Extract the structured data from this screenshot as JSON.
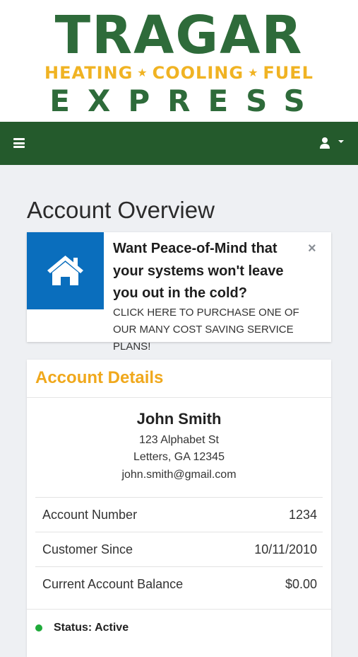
{
  "logo": {
    "title": "TRAGAR",
    "subtitle_parts": [
      "HEATING",
      "COOLING",
      "FUEL"
    ],
    "separator": "★",
    "express": "EXPRESS"
  },
  "navbar": {
    "menu_icon": "hamburger-icon",
    "user_icon": "user-icon",
    "dropdown_icon": "caret-down-icon"
  },
  "page": {
    "title": "Account Overview"
  },
  "promo": {
    "icon": "home-icon",
    "headline": "Want Peace-of-Mind that your systems won't leave you out in the cold?",
    "body": "CLICK HERE TO PURCHASE ONE OF OUR MANY COST SAVING SERVICE PLANS!",
    "close_label": "×"
  },
  "account": {
    "header": "Account Details",
    "name": "John Smith",
    "address_line1": "123 Alphabet St",
    "address_line2": "Letters, GA 12345",
    "email": "john.smith@gmail.com",
    "rows": [
      {
        "label": "Account Number",
        "value": "1234"
      },
      {
        "label": "Customer Since",
        "value": "10/11/2010"
      },
      {
        "label": "Current Account Balance",
        "value": "$0.00"
      }
    ],
    "status": "Status: Active"
  },
  "colors": {
    "brand_green": "#2e6b3a",
    "nav_green": "#245a2c",
    "brand_yellow": "#f0b323",
    "promo_blue": "#0a6ebd",
    "status_green": "#1faa3a"
  }
}
